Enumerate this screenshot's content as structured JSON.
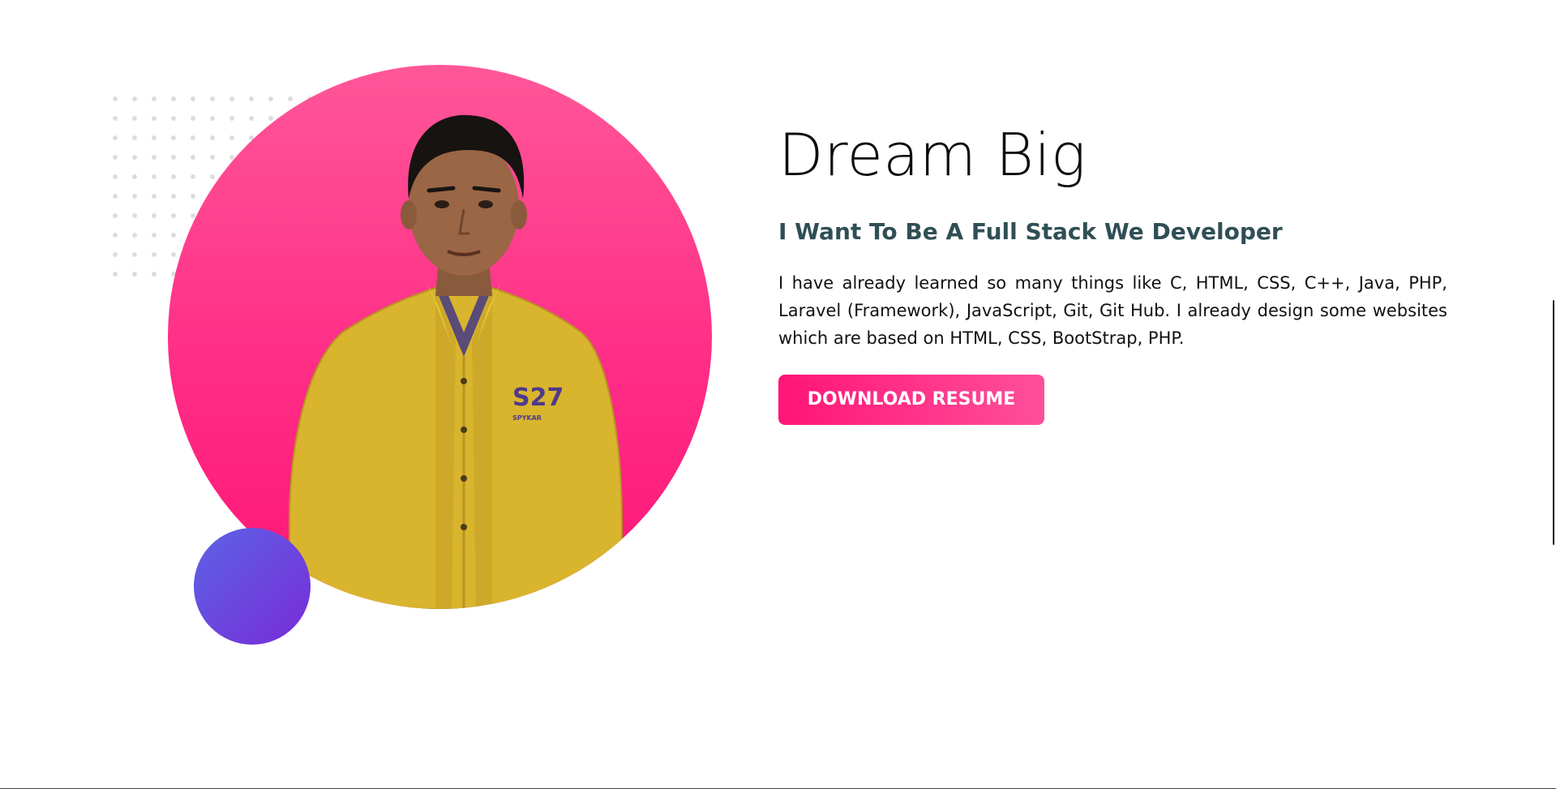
{
  "hero": {
    "title": "Dream Big",
    "subtitle": "I Want To Be A Full Stack We Developer",
    "description": "I have already learned so many things like C, HTML, CSS, C++, Java, PHP, Laravel (Framework), JavaScript, Git, Git Hub. I already design some websites which are based on HTML, CSS, BootStrap, PHP.",
    "button_label": "DOWNLOAD RESUME"
  },
  "portrait": {
    "shirt_text": "S27",
    "shirt_small_text": "SPYKAR"
  },
  "colors": {
    "accent_pink": "#ff1577",
    "accent_pink_light": "#ff5798",
    "accent_purple": "#7a2bd8",
    "accent_blue": "#5b63e6",
    "subtitle": "#2f4f55",
    "shirt_yellow": "#d8b52e"
  },
  "icons": {
    "decor_dots": "dot-grid",
    "decor_circle": "purple-circle"
  }
}
